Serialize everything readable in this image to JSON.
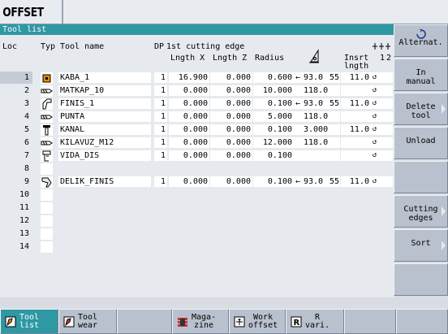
{
  "mode_title": "OFFSET",
  "panel_title": "Tool list",
  "headers": {
    "loc": "Loc",
    "typ": "Typ",
    "tool_name": "Tool name",
    "dp": "DP",
    "first_edge": "1st cutting edge",
    "length_x": "Lngth X",
    "length_z": "Lngth Z",
    "radius": "Radius",
    "insert_line1": "Insrt",
    "insert_line2": "lngth",
    "col_1": "1",
    "col_2": "2"
  },
  "rows": [
    {
      "loc": "1",
      "type_icon": "turning-tool-icon",
      "name": "KABA_1",
      "dp": "1",
      "length_x": "16.900",
      "length_z": "0.000",
      "radius": "0.600",
      "arrow": "←",
      "angle": "93.0",
      "angle2": "55",
      "insert": "11.0",
      "spindle": "↺",
      "selected": true
    },
    {
      "loc": "2",
      "type_icon": "drill-icon",
      "name": "MATKAP_10",
      "dp": "1",
      "length_x": "0.000",
      "length_z": "0.000",
      "radius": "10.000",
      "arrow": "",
      "angle": "118.0",
      "angle2": "",
      "insert": "",
      "spindle": "↺"
    },
    {
      "loc": "3",
      "type_icon": "finishing-tool-icon",
      "name": "FINIS_1",
      "dp": "1",
      "length_x": "0.000",
      "length_z": "0.000",
      "radius": "0.100",
      "arrow": "←",
      "angle": "93.0",
      "angle2": "55",
      "insert": "11.0",
      "spindle": "↺"
    },
    {
      "loc": "4",
      "type_icon": "drill-icon",
      "name": "PUNTA",
      "dp": "1",
      "length_x": "0.000",
      "length_z": "0.000",
      "radius": "5.000",
      "arrow": "",
      "angle": "118.0",
      "angle2": "",
      "insert": "",
      "spindle": "↺"
    },
    {
      "loc": "5",
      "type_icon": "grooving-tool-icon",
      "name": "KANAL",
      "dp": "1",
      "length_x": "0.000",
      "length_z": "0.000",
      "radius": "0.100",
      "arrow": "",
      "angle": "3.000",
      "angle2": "",
      "insert": "11.0",
      "spindle": "↺"
    },
    {
      "loc": "6",
      "type_icon": "drill-icon",
      "name": "KILAVUZ_M12",
      "dp": "1",
      "length_x": "0.000",
      "length_z": "0.000",
      "radius": "12.000",
      "arrow": "",
      "angle": "118.0",
      "angle2": "",
      "insert": "",
      "spindle": "↺"
    },
    {
      "loc": "7",
      "type_icon": "threading-tool-icon",
      "name": "VIDA_DIS",
      "dp": "1",
      "length_x": "0.000",
      "length_z": "0.000",
      "radius": "0.100",
      "arrow": "",
      "angle": "",
      "angle2": "",
      "insert": "",
      "spindle": "↺"
    },
    {
      "loc": "8",
      "type_icon": "",
      "name": "",
      "empty": true
    },
    {
      "loc": "9",
      "type_icon": "boring-tool-icon",
      "name": "DELIK_FINIS",
      "dp": "1",
      "length_x": "0.000",
      "length_z": "0.000",
      "radius": "0.100",
      "arrow": "←",
      "angle": "93.0",
      "angle2": "55",
      "insert": "11.0",
      "spindle": "↺"
    },
    {
      "loc": "10",
      "type_icon": "",
      "name": "",
      "empty": true
    },
    {
      "loc": "11",
      "type_icon": "",
      "name": "",
      "empty": true
    },
    {
      "loc": "12",
      "type_icon": "",
      "name": "",
      "empty": true
    },
    {
      "loc": "13",
      "type_icon": "",
      "name": "",
      "empty": true
    },
    {
      "loc": "14",
      "type_icon": "",
      "name": "",
      "empty": true
    }
  ],
  "right_softkeys": [
    {
      "label": "Alternat.",
      "icon": "rotate-icon",
      "arrow": false
    },
    {
      "label": "In\nmanual",
      "arrow": false
    },
    {
      "label": "Delete\ntool",
      "arrow": true
    },
    {
      "label": "Unload",
      "arrow": false
    },
    {
      "label": "",
      "arrow": false
    },
    {
      "label": "Cutting\nedges",
      "arrow": true
    },
    {
      "label": "Sort",
      "arrow": true
    },
    {
      "label": "",
      "arrow": false
    }
  ],
  "bottom_softkeys": [
    {
      "label": "Tool\nlist",
      "icon": "tool-list-icon",
      "active": true
    },
    {
      "label": "Tool\nwear",
      "icon": "tool-wear-icon",
      "active": false
    },
    {
      "label": "",
      "active": false
    },
    {
      "label": "Maga-\nzine",
      "icon": "magazine-icon",
      "active": false
    },
    {
      "label": "Work\noffset",
      "icon": "work-offset-icon",
      "active": false
    },
    {
      "label": "R\nvari.",
      "icon": "r-variable-icon",
      "active": false
    },
    {
      "label": "",
      "active": false
    },
    {
      "label": "",
      "active": false
    }
  ],
  "colors": {
    "title_bar": "#2e98a3",
    "softkey_bg": "#b8c1cd",
    "panel_bg": "#e6e9ee",
    "cell_bg": "#ffffff"
  }
}
